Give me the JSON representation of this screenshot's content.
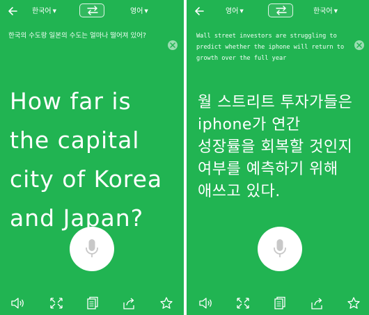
{
  "left": {
    "source_language": "한국어",
    "target_language": "영어",
    "source_text": "한국의 수도랑 일본의 수도는 얼마나 떨어져 있어?",
    "translation": "How far is\nthe capital\ncity of Korea\nand Japan?"
  },
  "right": {
    "source_language": "영어",
    "target_language": "한국어",
    "source_text": "Wall street investors are struggling to predict whether the iphone will return to growth over the full year",
    "translation": "월 스트리트 투자가들은\niphone가 연간\n성장률을 회복할 것인지\n여부를 예측하기 위해\n애쓰고 있다."
  },
  "icons": {
    "back": "back-arrow-icon",
    "swap": "swap-arrows-icon",
    "clear": "close-icon",
    "mic": "microphone-icon",
    "speaker": "speaker-icon",
    "fullscreen": "expand-icon",
    "copy": "copy-icon",
    "share": "share-icon",
    "favorite": "star-icon"
  },
  "colors": {
    "background": "#21b452",
    "text": "#ffffff",
    "mic_button": "#ffffff",
    "mic_glyph": "#c8c8c8"
  }
}
